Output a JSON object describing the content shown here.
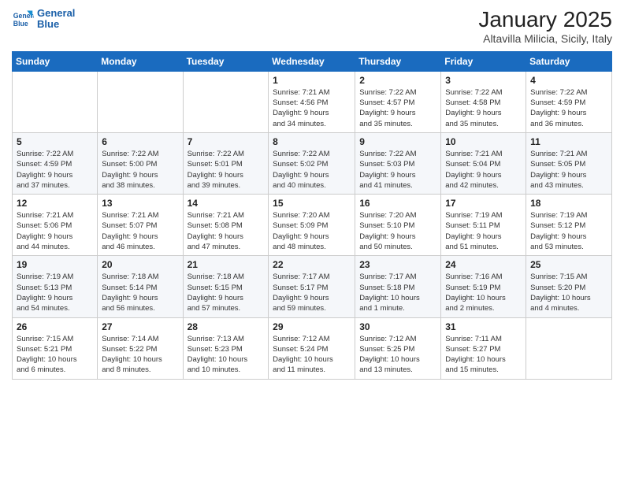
{
  "header": {
    "logo_line1": "General",
    "logo_line2": "Blue",
    "calendar_title": "January 2025",
    "calendar_subtitle": "Altavilla Milicia, Sicily, Italy"
  },
  "weekdays": [
    "Sunday",
    "Monday",
    "Tuesday",
    "Wednesday",
    "Thursday",
    "Friday",
    "Saturday"
  ],
  "weeks": [
    [
      {
        "day": "",
        "info": ""
      },
      {
        "day": "",
        "info": ""
      },
      {
        "day": "",
        "info": ""
      },
      {
        "day": "1",
        "info": "Sunrise: 7:21 AM\nSunset: 4:56 PM\nDaylight: 9 hours\nand 34 minutes."
      },
      {
        "day": "2",
        "info": "Sunrise: 7:22 AM\nSunset: 4:57 PM\nDaylight: 9 hours\nand 35 minutes."
      },
      {
        "day": "3",
        "info": "Sunrise: 7:22 AM\nSunset: 4:58 PM\nDaylight: 9 hours\nand 35 minutes."
      },
      {
        "day": "4",
        "info": "Sunrise: 7:22 AM\nSunset: 4:59 PM\nDaylight: 9 hours\nand 36 minutes."
      }
    ],
    [
      {
        "day": "5",
        "info": "Sunrise: 7:22 AM\nSunset: 4:59 PM\nDaylight: 9 hours\nand 37 minutes."
      },
      {
        "day": "6",
        "info": "Sunrise: 7:22 AM\nSunset: 5:00 PM\nDaylight: 9 hours\nand 38 minutes."
      },
      {
        "day": "7",
        "info": "Sunrise: 7:22 AM\nSunset: 5:01 PM\nDaylight: 9 hours\nand 39 minutes."
      },
      {
        "day": "8",
        "info": "Sunrise: 7:22 AM\nSunset: 5:02 PM\nDaylight: 9 hours\nand 40 minutes."
      },
      {
        "day": "9",
        "info": "Sunrise: 7:22 AM\nSunset: 5:03 PM\nDaylight: 9 hours\nand 41 minutes."
      },
      {
        "day": "10",
        "info": "Sunrise: 7:21 AM\nSunset: 5:04 PM\nDaylight: 9 hours\nand 42 minutes."
      },
      {
        "day": "11",
        "info": "Sunrise: 7:21 AM\nSunset: 5:05 PM\nDaylight: 9 hours\nand 43 minutes."
      }
    ],
    [
      {
        "day": "12",
        "info": "Sunrise: 7:21 AM\nSunset: 5:06 PM\nDaylight: 9 hours\nand 44 minutes."
      },
      {
        "day": "13",
        "info": "Sunrise: 7:21 AM\nSunset: 5:07 PM\nDaylight: 9 hours\nand 46 minutes."
      },
      {
        "day": "14",
        "info": "Sunrise: 7:21 AM\nSunset: 5:08 PM\nDaylight: 9 hours\nand 47 minutes."
      },
      {
        "day": "15",
        "info": "Sunrise: 7:20 AM\nSunset: 5:09 PM\nDaylight: 9 hours\nand 48 minutes."
      },
      {
        "day": "16",
        "info": "Sunrise: 7:20 AM\nSunset: 5:10 PM\nDaylight: 9 hours\nand 50 minutes."
      },
      {
        "day": "17",
        "info": "Sunrise: 7:19 AM\nSunset: 5:11 PM\nDaylight: 9 hours\nand 51 minutes."
      },
      {
        "day": "18",
        "info": "Sunrise: 7:19 AM\nSunset: 5:12 PM\nDaylight: 9 hours\nand 53 minutes."
      }
    ],
    [
      {
        "day": "19",
        "info": "Sunrise: 7:19 AM\nSunset: 5:13 PM\nDaylight: 9 hours\nand 54 minutes."
      },
      {
        "day": "20",
        "info": "Sunrise: 7:18 AM\nSunset: 5:14 PM\nDaylight: 9 hours\nand 56 minutes."
      },
      {
        "day": "21",
        "info": "Sunrise: 7:18 AM\nSunset: 5:15 PM\nDaylight: 9 hours\nand 57 minutes."
      },
      {
        "day": "22",
        "info": "Sunrise: 7:17 AM\nSunset: 5:17 PM\nDaylight: 9 hours\nand 59 minutes."
      },
      {
        "day": "23",
        "info": "Sunrise: 7:17 AM\nSunset: 5:18 PM\nDaylight: 10 hours\nand 1 minute."
      },
      {
        "day": "24",
        "info": "Sunrise: 7:16 AM\nSunset: 5:19 PM\nDaylight: 10 hours\nand 2 minutes."
      },
      {
        "day": "25",
        "info": "Sunrise: 7:15 AM\nSunset: 5:20 PM\nDaylight: 10 hours\nand 4 minutes."
      }
    ],
    [
      {
        "day": "26",
        "info": "Sunrise: 7:15 AM\nSunset: 5:21 PM\nDaylight: 10 hours\nand 6 minutes."
      },
      {
        "day": "27",
        "info": "Sunrise: 7:14 AM\nSunset: 5:22 PM\nDaylight: 10 hours\nand 8 minutes."
      },
      {
        "day": "28",
        "info": "Sunrise: 7:13 AM\nSunset: 5:23 PM\nDaylight: 10 hours\nand 10 minutes."
      },
      {
        "day": "29",
        "info": "Sunrise: 7:12 AM\nSunset: 5:24 PM\nDaylight: 10 hours\nand 11 minutes."
      },
      {
        "day": "30",
        "info": "Sunrise: 7:12 AM\nSunset: 5:25 PM\nDaylight: 10 hours\nand 13 minutes."
      },
      {
        "day": "31",
        "info": "Sunrise: 7:11 AM\nSunset: 5:27 PM\nDaylight: 10 hours\nand 15 minutes."
      },
      {
        "day": "",
        "info": ""
      }
    ]
  ]
}
